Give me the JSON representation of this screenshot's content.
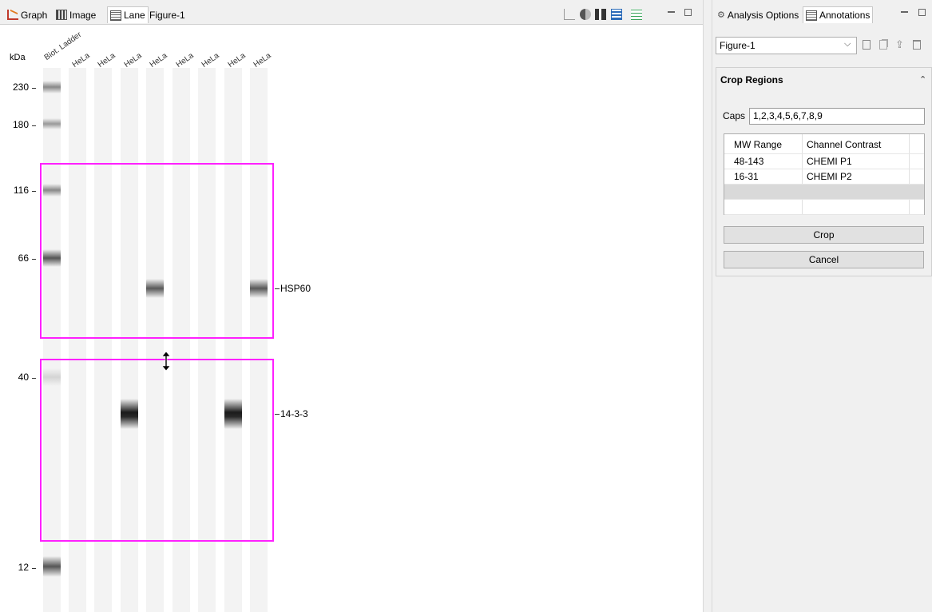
{
  "editor_tabs": [
    {
      "label": "Graph",
      "icon": "graph-icon"
    },
    {
      "label": "Image",
      "icon": "image-icon"
    },
    {
      "label": "Lane",
      "icon": "lane-icon"
    },
    {
      "label": "Figure-1"
    }
  ],
  "lane_view": {
    "axis_unit": "kDa",
    "column_labels": [
      "Biot. Ladder",
      "HeLa",
      "HeLa",
      "HeLa",
      "HeLa",
      "HeLa",
      "HeLa",
      "HeLa",
      "HeLa"
    ],
    "mw_markers": [
      "230",
      "180",
      "116",
      "66",
      "40",
      "12"
    ],
    "annotations": [
      "HSP60",
      "14-3-3"
    ]
  },
  "right_panel": {
    "tabs": [
      {
        "label": "Analysis Options",
        "icon": "analysis-options-icon"
      },
      {
        "label": "Annotations",
        "icon": "annotations-icon"
      }
    ],
    "figure_select": {
      "value": "Figure-1"
    },
    "crop_regions": {
      "title": "Crop Regions",
      "caps_label": "Caps",
      "caps_value": "1,2,3,4,5,6,7,8,9",
      "table": {
        "headers": [
          "MW Range",
          "Channel Contrast"
        ],
        "rows": [
          [
            "48-143",
            "CHEMI P1"
          ],
          [
            "16-31",
            "CHEMI P2"
          ]
        ]
      },
      "crop_button": "Crop",
      "cancel_button": "Cancel"
    }
  },
  "colors": {
    "crop_box": "#ff20ff",
    "panel_bg": "#f0f0f0"
  }
}
